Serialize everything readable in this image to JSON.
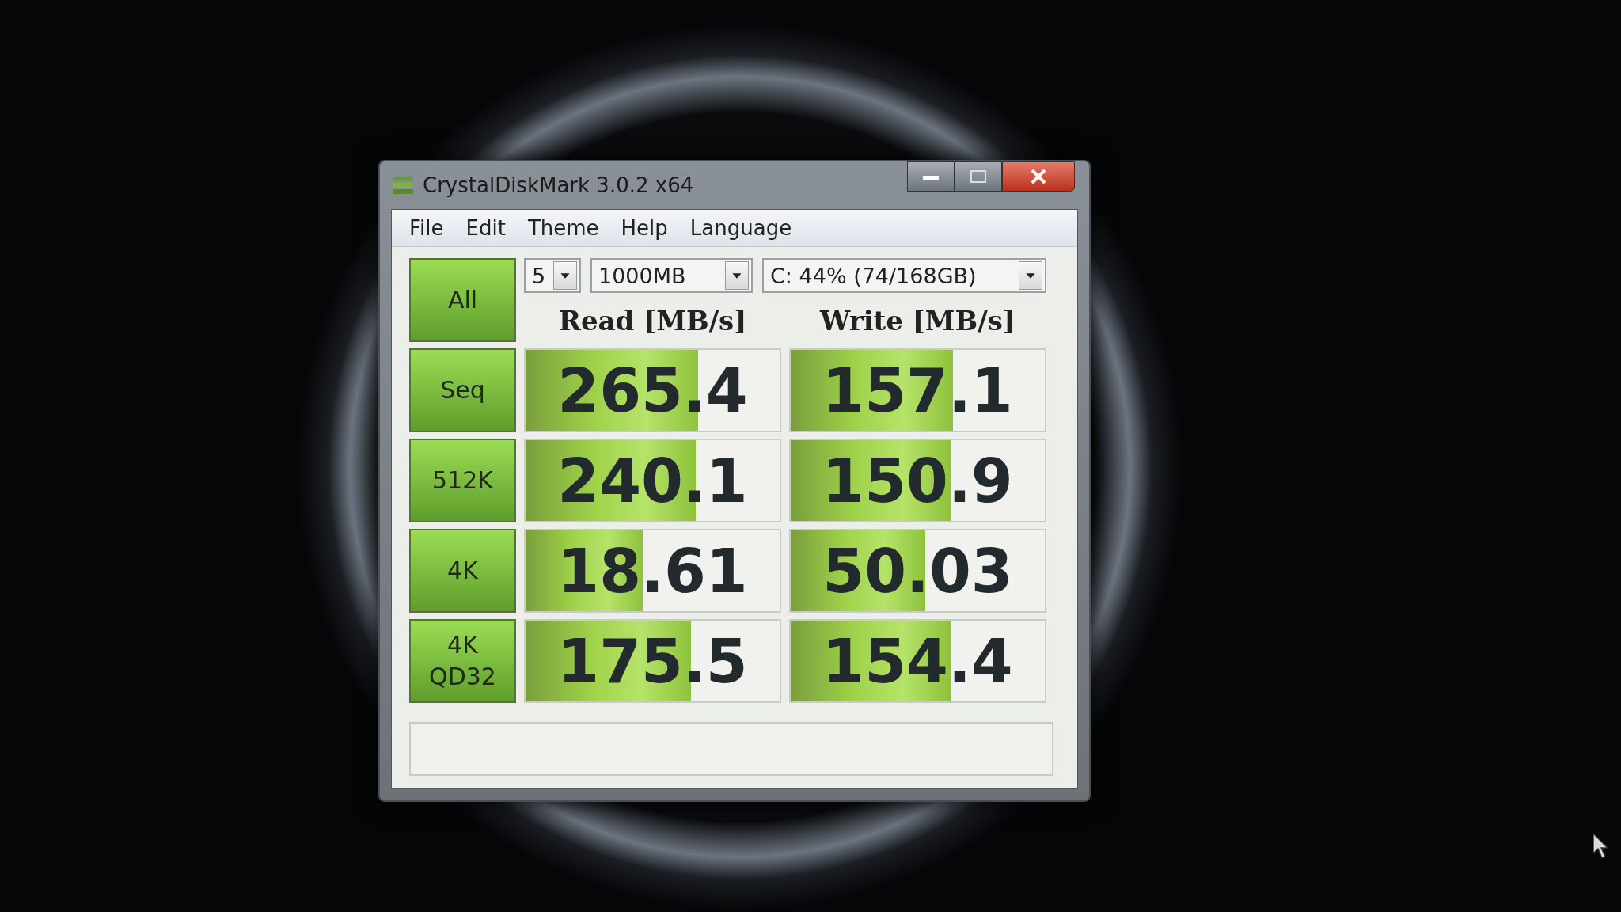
{
  "window": {
    "title": "CrystalDiskMark 3.0.2 x64"
  },
  "menu": [
    "File",
    "Edit",
    "Theme",
    "Help",
    "Language"
  ],
  "all_button": "All",
  "controls": {
    "runs": "5",
    "size": "1000MB",
    "drive": "C: 44% (74/168GB)"
  },
  "columns": [
    "Read [MB/s]",
    "Write [MB/s]"
  ],
  "rows": [
    {
      "label": "Seq",
      "read": {
        "value": "265.4",
        "level": 0.68
      },
      "write": {
        "value": "157.1",
        "level": 0.64
      }
    },
    {
      "label": "512K",
      "read": {
        "value": "240.1",
        "level": 0.67
      },
      "write": {
        "value": "150.9",
        "level": 0.63
      }
    },
    {
      "label": "4K",
      "read": {
        "value": "18.61",
        "level": 0.46
      },
      "write": {
        "value": "50.03",
        "level": 0.53
      }
    },
    {
      "label": "4K QD32",
      "read": {
        "value": "175.5",
        "level": 0.65
      },
      "write": {
        "value": "154.4",
        "level": 0.63
      }
    }
  ]
}
